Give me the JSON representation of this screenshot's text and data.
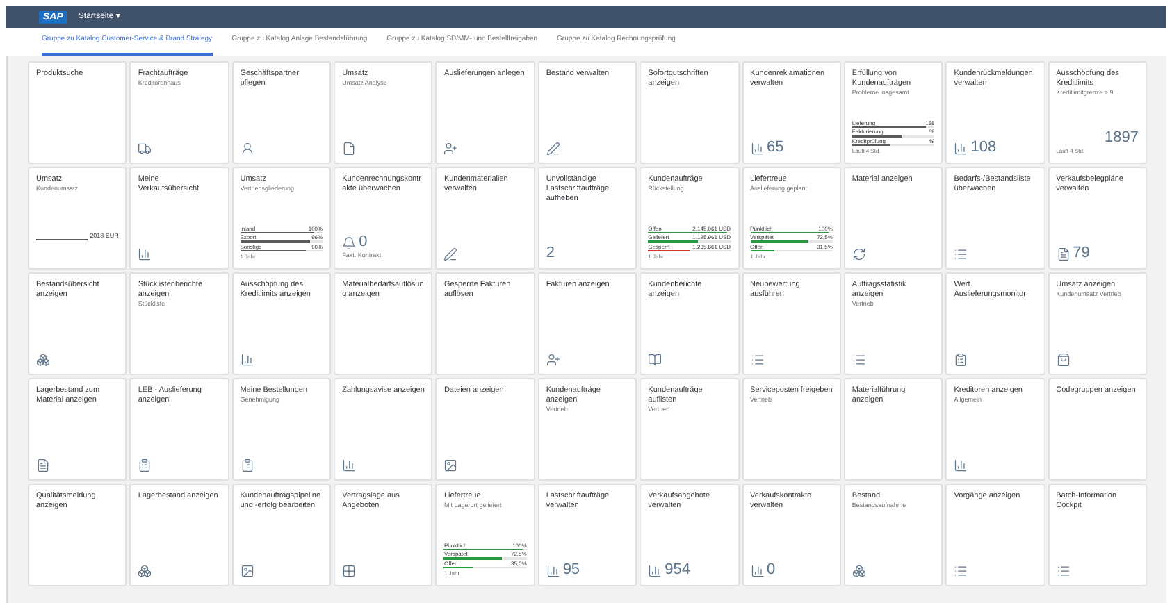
{
  "shell": {
    "logo": "SAP",
    "title": "Startseite ▾"
  },
  "tabs": [
    {
      "label": "Gruppe zu Katalog Customer-Service & Brand Strategy",
      "selected": true
    },
    {
      "label": "Gruppe zu Katalog Anlage Bestandsführung",
      "selected": false
    },
    {
      "label": "Gruppe zu Katalog SD/MM- und Bestellfreigaben",
      "selected": false
    },
    {
      "label": "Gruppe zu Katalog Rechnungsprüfung",
      "selected": false
    }
  ],
  "rows": [
    [
      {
        "kind": "text",
        "title": "Produktsuche"
      },
      {
        "kind": "icon",
        "title": "Frachtaufträge",
        "subtitle": "Kreditorenhaus"
      },
      {
        "kind": "icon",
        "title": "Geschäftspartner pflegen"
      },
      {
        "kind": "icon",
        "title": "Umsatz",
        "subtitle": "Umsatz Analyse"
      },
      {
        "kind": "icon",
        "title": "Auslieferungen anlegen"
      },
      {
        "kind": "icon",
        "title": "Bestand verwalten"
      },
      {
        "kind": "text",
        "title": "Sofortgutschriften anzeigen"
      },
      {
        "kind": "number",
        "title": "Kundenreklamationen verwalten",
        "value": "65"
      },
      {
        "kind": "bars",
        "title": "Erfüllung von Kundenaufträgen",
        "subtitle": "Probleme insgesamt",
        "bars": [
          {
            "label": "Lieferung",
            "value": "158",
            "level": 0.9,
            "color": "#5a5a5a"
          },
          {
            "label": "Fakturierung",
            "value": "69",
            "level": 0.6,
            "color": "#5a5a5a"
          },
          {
            "label": "Kreditprüfung",
            "value": "49",
            "level": 0.45,
            "color": "#5a5a5a"
          }
        ],
        "footer": "Läuft 4 Std."
      },
      {
        "kind": "number",
        "title": "Kundenrückmeldungen verwalten",
        "value": "108"
      },
      {
        "kind": "number",
        "title": "Ausschöpfung des Kreditlimits",
        "subtitle": "Kreditlimitgrenze > 9...",
        "value": "1897",
        "footer": "Läuft 4 Std."
      }
    ],
    [
      {
        "kind": "line",
        "title": "Umsatz",
        "subtitle": "Kundenumsatz",
        "value": "2018 EUR"
      },
      {
        "kind": "icon",
        "title": "Meine Verkaufsübersicht"
      },
      {
        "kind": "bars",
        "title": "Umsatz",
        "subtitle": "Vertriebsgliederung",
        "bars": [
          {
            "label": "Inland",
            "value": "100%",
            "level": 0.9,
            "color": "#5a5a5a"
          },
          {
            "label": "Export",
            "value": "96%",
            "level": 0.85,
            "color": "#5a5a5a"
          },
          {
            "label": "Sonstige",
            "value": "90%",
            "level": 0.8,
            "color": "#5a5a5a"
          }
        ],
        "footer": "1 Jahr"
      },
      {
        "kind": "number",
        "title": "Kundenrechnungskontrakte überwachen",
        "value": "0",
        "caption": "Fakt. Kontrakt"
      },
      {
        "kind": "icon",
        "title": "Kundenmaterialien verwalten"
      },
      {
        "kind": "number",
        "title": "Unvollständige Lastschriftaufträge aufheben",
        "value": "2"
      },
      {
        "kind": "bars",
        "title": "Kundenaufträge",
        "subtitle": "Rückstellung",
        "bars": [
          {
            "label": "Offen",
            "value": "2.145.061 USD",
            "level": 0.95,
            "color": "#2b9a3e"
          },
          {
            "label": "Geliefert",
            "value": "1.125.961 USD",
            "level": 0.6,
            "color": "#2b9a3e"
          },
          {
            "label": "Gesperrt",
            "value": "1.235.861 USD",
            "level": 0.5,
            "color": "#d03a3a"
          }
        ],
        "footer": "1 Jahr"
      },
      {
        "kind": "bars",
        "title": "Liefertreue",
        "subtitle": "Auslieferung geplant",
        "bars": [
          {
            "label": "Pünktlich",
            "value": "100%",
            "level": 0.95,
            "color": "#2b9a3e"
          },
          {
            "label": "Verspätet",
            "value": "72,5%",
            "level": 0.7,
            "color": "#2b9a3e"
          },
          {
            "label": "Offen",
            "value": "31,5%",
            "level": 0.3,
            "color": "#2b9a3e"
          }
        ],
        "footer": "1 Jahr"
      },
      {
        "kind": "icon",
        "title": "Material anzeigen"
      },
      {
        "kind": "icon",
        "title": "Bedarfs-/Bestandsliste überwachen"
      },
      {
        "kind": "number",
        "title": "Verkaufsbelegpläne verwalten",
        "value": "79"
      }
    ],
    [
      {
        "kind": "icon",
        "title": "Bestandsübersicht anzeigen"
      },
      {
        "kind": "text",
        "title": "Stücklistenberichte anzeigen",
        "subtitle": "Stückliste"
      },
      {
        "kind": "icon",
        "title": "Ausschöpfung des Kreditlimits anzeigen"
      },
      {
        "kind": "text",
        "title": "Materialbedarfsauflösung anzeigen"
      },
      {
        "kind": "text",
        "title": "Gesperrte Fakturen auflösen"
      },
      {
        "kind": "icon",
        "title": "Fakturen anzeigen"
      },
      {
        "kind": "icon",
        "title": "Kundenberichte anzeigen"
      },
      {
        "kind": "icon",
        "title": "Neubewertung ausführen"
      },
      {
        "kind": "icon",
        "title": "Auftragsstatistik anzeigen",
        "subtitle": "Vertrieb"
      },
      {
        "kind": "icon",
        "title": "Wert. Auslieferungsmonitor"
      },
      {
        "kind": "icon",
        "title": "Umsatz anzeigen",
        "subtitle": "Kundenumsatz Vertrieb"
      }
    ],
    [
      {
        "kind": "icon",
        "title": "Lagerbestand zum Material anzeigen"
      },
      {
        "kind": "icon",
        "title": "LEB - Auslieferung anzeigen"
      },
      {
        "kind": "icon",
        "title": "Meine Bestellungen",
        "subtitle": "Genehmigung"
      },
      {
        "kind": "icon",
        "title": "Zahlungsavise anzeigen"
      },
      {
        "kind": "icon",
        "title": "Dateien anzeigen"
      },
      {
        "kind": "text",
        "title": "Kundenaufträge anzeigen",
        "subtitle": "Vertrieb"
      },
      {
        "kind": "text",
        "title": "Kundenaufträge auflisten",
        "subtitle": "Vertrieb"
      },
      {
        "kind": "text",
        "title": "Serviceposten freigeben",
        "subtitle": "Vertrieb"
      },
      {
        "kind": "text",
        "title": "Materialführung anzeigen"
      },
      {
        "kind": "icon",
        "title": "Kreditoren anzeigen",
        "subtitle": "Allgemein"
      },
      {
        "kind": "text",
        "title": "Codegruppen anzeigen"
      }
    ],
    [
      {
        "kind": "text",
        "title": "Qualitätsmeldung anzeigen"
      },
      {
        "kind": "icon",
        "title": "Lagerbestand anzeigen"
      },
      {
        "kind": "icon",
        "title": "Kundenauftragspipeline und -erfolg bearbeiten"
      },
      {
        "kind": "icon",
        "title": "Vertragslage aus Angeboten"
      },
      {
        "kind": "bars",
        "title": "Liefertreue",
        "subtitle": "Mit Lagerort geliefert",
        "bars": [
          {
            "label": "Pünktlich",
            "value": "100%",
            "level": 0.95,
            "color": "#2b9a3e"
          },
          {
            "label": "Verspätet",
            "value": "72,5%",
            "level": 0.7,
            "color": "#2b9a3e"
          },
          {
            "label": "Offen",
            "value": "35,0%",
            "level": 0.35,
            "color": "#2b9a3e"
          }
        ],
        "footer": "1 Jahr"
      },
      {
        "kind": "number",
        "title": "Lastschriftaufträge verwalten",
        "value": "95"
      },
      {
        "kind": "number",
        "title": "Verkaufsangebote verwalten",
        "value": "954"
      },
      {
        "kind": "number",
        "title": "Verkaufskontrakte verwalten",
        "value": "0"
      },
      {
        "kind": "icon",
        "title": "Bestand",
        "subtitle": "Bestandsaufnahme"
      },
      {
        "kind": "icon",
        "title": "Vorgänge anzeigen"
      },
      {
        "kind": "icon",
        "title": "Batch-Information Cockpit"
      }
    ]
  ]
}
